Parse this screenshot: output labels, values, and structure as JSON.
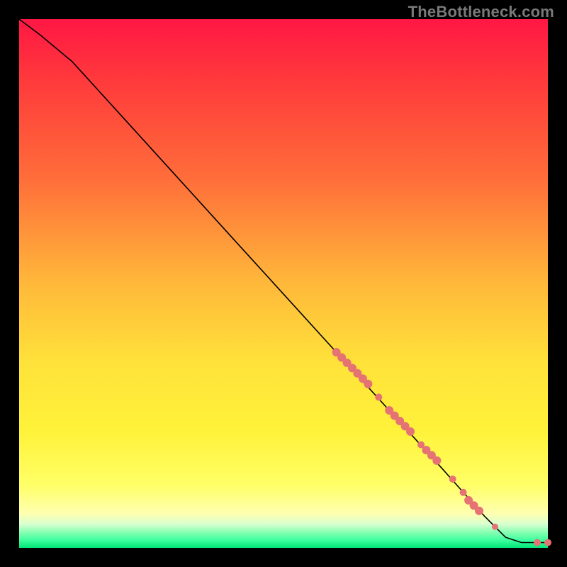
{
  "watermark": "TheBottleneck.com",
  "colors": {
    "background": "#000000",
    "curve": "#000000",
    "marker_fill": "#e57373",
    "gradient_stops": [
      {
        "offset": 0.0,
        "color": "#ff1744"
      },
      {
        "offset": 0.12,
        "color": "#ff3b3b"
      },
      {
        "offset": 0.3,
        "color": "#ff6d3a"
      },
      {
        "offset": 0.5,
        "color": "#ffb83a"
      },
      {
        "offset": 0.65,
        "color": "#ffe23a"
      },
      {
        "offset": 0.78,
        "color": "#fff23a"
      },
      {
        "offset": 0.88,
        "color": "#ffff66"
      },
      {
        "offset": 0.935,
        "color": "#ffffb0"
      },
      {
        "offset": 0.955,
        "color": "#d9ffd0"
      },
      {
        "offset": 0.972,
        "color": "#7fffb0"
      },
      {
        "offset": 0.985,
        "color": "#40ffa0"
      },
      {
        "offset": 1.0,
        "color": "#00e676"
      }
    ]
  },
  "chart_data": {
    "type": "line",
    "title": "",
    "xlabel": "",
    "ylabel": "",
    "xlim": [
      0,
      100
    ],
    "ylim": [
      0,
      100
    ],
    "legend": false,
    "grid": false,
    "curve": [
      {
        "x": 0,
        "y": 100
      },
      {
        "x": 4,
        "y": 97
      },
      {
        "x": 10,
        "y": 92
      },
      {
        "x": 20,
        "y": 81
      },
      {
        "x": 30,
        "y": 70
      },
      {
        "x": 40,
        "y": 59
      },
      {
        "x": 50,
        "y": 48
      },
      {
        "x": 60,
        "y": 37
      },
      {
        "x": 70,
        "y": 26
      },
      {
        "x": 80,
        "y": 15
      },
      {
        "x": 88,
        "y": 6
      },
      {
        "x": 92,
        "y": 2
      },
      {
        "x": 95,
        "y": 1
      },
      {
        "x": 100,
        "y": 1
      }
    ],
    "markers": [
      {
        "x": 60,
        "y": 37,
        "r": 6
      },
      {
        "x": 61,
        "y": 36,
        "r": 6
      },
      {
        "x": 62,
        "y": 35,
        "r": 6
      },
      {
        "x": 63,
        "y": 34,
        "r": 6
      },
      {
        "x": 64,
        "y": 33,
        "r": 6
      },
      {
        "x": 65,
        "y": 32,
        "r": 6
      },
      {
        "x": 66,
        "y": 31,
        "r": 6
      },
      {
        "x": 68,
        "y": 28.5,
        "r": 5
      },
      {
        "x": 70,
        "y": 26,
        "r": 6
      },
      {
        "x": 71,
        "y": 25,
        "r": 6
      },
      {
        "x": 72,
        "y": 24,
        "r": 6
      },
      {
        "x": 73,
        "y": 23,
        "r": 6
      },
      {
        "x": 74,
        "y": 22,
        "r": 6
      },
      {
        "x": 76,
        "y": 19.5,
        "r": 5
      },
      {
        "x": 77,
        "y": 18.5,
        "r": 6
      },
      {
        "x": 78,
        "y": 17.5,
        "r": 6
      },
      {
        "x": 79,
        "y": 16.5,
        "r": 6
      },
      {
        "x": 82,
        "y": 13,
        "r": 5
      },
      {
        "x": 84,
        "y": 10.5,
        "r": 5
      },
      {
        "x": 85,
        "y": 9,
        "r": 6
      },
      {
        "x": 86,
        "y": 8,
        "r": 6
      },
      {
        "x": 87,
        "y": 7,
        "r": 6
      },
      {
        "x": 90,
        "y": 4,
        "r": 4.5
      },
      {
        "x": 98,
        "y": 1,
        "r": 5
      },
      {
        "x": 100,
        "y": 1,
        "r": 5
      }
    ]
  }
}
